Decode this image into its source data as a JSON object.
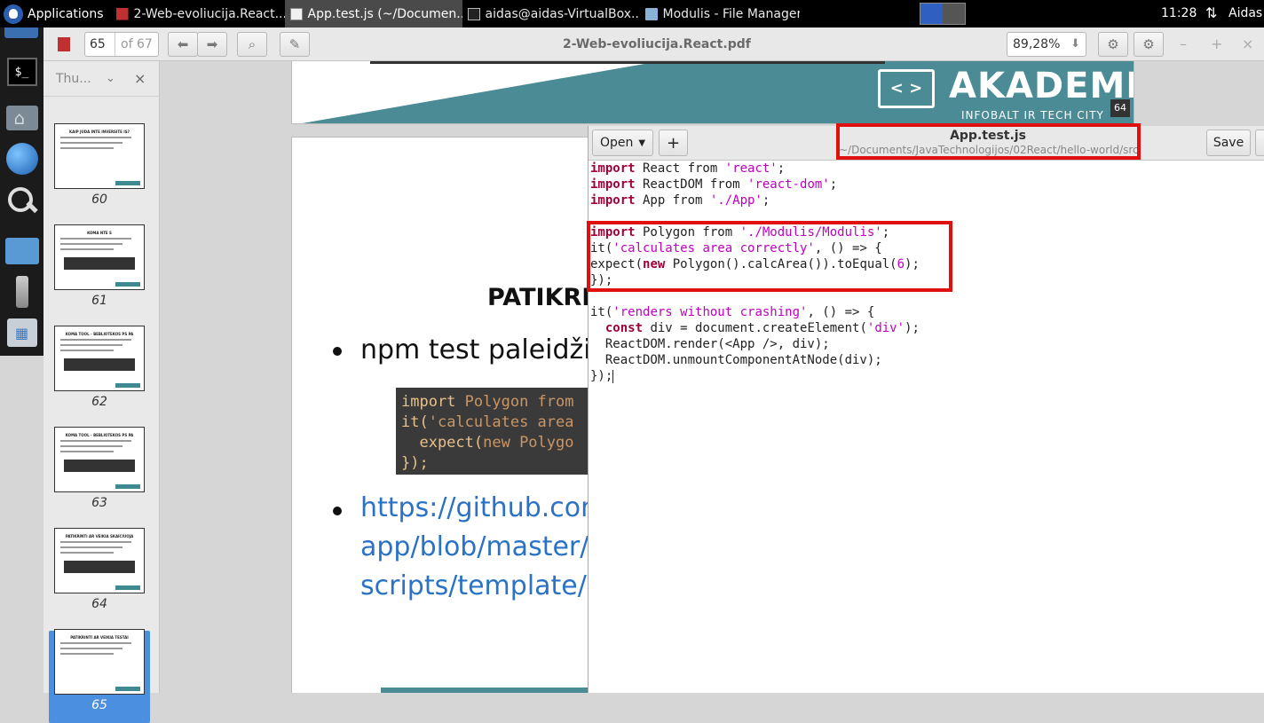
{
  "top_panel": {
    "applications_label": "Applications",
    "tasks": [
      {
        "label": "2-Web-evoliucija.React....",
        "icon": "pdf-icon",
        "active": false
      },
      {
        "label": "App.test.js (~/Documen...",
        "icon": "text-editor-icon",
        "active": true
      },
      {
        "label": "aidas@aidas-VirtualBox...",
        "icon": "terminal-icon",
        "active": false
      },
      {
        "label": "Modulis - File Manager",
        "icon": "folder-icon",
        "active": false
      }
    ],
    "clock": "11:28",
    "network_icon": "network-arrows-icon",
    "user": "Aidas"
  },
  "dock": {
    "items": [
      "terminal-icon",
      "home-icon",
      "web-browser-icon",
      "search-icon",
      "folder-icon",
      "usb-drive-icon",
      "app-store-icon"
    ],
    "terminal_glyph": "$_"
  },
  "viewer": {
    "page_current": "65",
    "page_of": "of 67",
    "title": "2-Web-evoliucija.React.pdf",
    "zoom": "89,28%",
    "sidebar_label": "Thu...",
    "thumbnails": [
      {
        "num": "60",
        "title": "KAIP JUDA INTE INVERSITE IS?"
      },
      {
        "num": "61",
        "title": "KOMA NTE S"
      },
      {
        "num": "62",
        "title": "KOMA TOOL - BEBLIOTEKOS PS PA"
      },
      {
        "num": "63",
        "title": "KOMA TOOL - BEBLIOTEKOS PS PA"
      },
      {
        "num": "64",
        "title": "PATIKRINTI AR VEIKIA SKAICIUOJA"
      },
      {
        "num": "65",
        "title": "PATIKRINTI AR VEIKIA TESTAI"
      }
    ],
    "selected_thumbnail": "65",
    "prev_page": {
      "brand": "AKADEMIJA.IT",
      "brand_sub": "INFOBALT IR TECH CITY",
      "brand_icon": "< >",
      "page_number": "64"
    },
    "slide": {
      "title": "PATIKRI",
      "bullet1": "npm test paleidžia",
      "code_lines": [
        {
          "kw": "import",
          "rest": " Polygon from"
        },
        {
          "kw": "it(",
          "rest": "'calculates area"
        },
        {
          "kw": "  expect(",
          "rest": "new Polygo"
        },
        {
          "kw": "});",
          "rest": ""
        }
      ],
      "link_lines": [
        "https://github.con",
        "app/blob/master/",
        "scripts/template/F"
      ]
    }
  },
  "editor": {
    "open_label": "Open",
    "new_tab_label": "+",
    "file_name": "App.test.js",
    "file_path": "~/Documents/JavaTechnologijos/02React/hello-world/src",
    "save_label": "Save",
    "code": [
      [
        {
          "t": "import",
          "c": "k"
        },
        {
          "t": " React from "
        },
        {
          "t": "'react'",
          "c": "s"
        },
        {
          "t": ";"
        }
      ],
      [
        {
          "t": "import",
          "c": "k"
        },
        {
          "t": " ReactDOM from "
        },
        {
          "t": "'react-dom'",
          "c": "s"
        },
        {
          "t": ";"
        }
      ],
      [
        {
          "t": "import",
          "c": "k"
        },
        {
          "t": " App from "
        },
        {
          "t": "'./App'",
          "c": "s"
        },
        {
          "t": ";"
        }
      ],
      [],
      [
        {
          "t": "import",
          "c": "k"
        },
        {
          "t": " Polygon from "
        },
        {
          "t": "'./Modulis/Modulis'",
          "c": "s"
        },
        {
          "t": ";"
        }
      ],
      [
        {
          "t": "it("
        },
        {
          "t": "'calculates area correctly'",
          "c": "s"
        },
        {
          "t": ", () => {"
        }
      ],
      [
        {
          "t": "expect("
        },
        {
          "t": "new",
          "c": "k"
        },
        {
          "t": " Polygon().calcArea()).toEqual("
        },
        {
          "t": "6",
          "c": "n"
        },
        {
          "t": ");"
        }
      ],
      [
        {
          "t": "});"
        }
      ],
      [],
      [
        {
          "t": "it("
        },
        {
          "t": "'renders without crashing'",
          "c": "s"
        },
        {
          "t": ", () => {"
        }
      ],
      [
        {
          "t": "  "
        },
        {
          "t": "const",
          "c": "k"
        },
        {
          "t": " div = document.createElement("
        },
        {
          "t": "'div'",
          "c": "s"
        },
        {
          "t": ");"
        }
      ],
      [
        {
          "t": "  ReactDOM.render(<App />, div);"
        }
      ],
      [
        {
          "t": "  ReactDOM.unmountComponentAtNode(div);"
        }
      ],
      [
        {
          "t": "});"
        }
      ]
    ]
  },
  "colors": {
    "highlight_red": "#e01010",
    "slide_teal": "#4a8b95",
    "link_blue": "#2a72c6"
  }
}
